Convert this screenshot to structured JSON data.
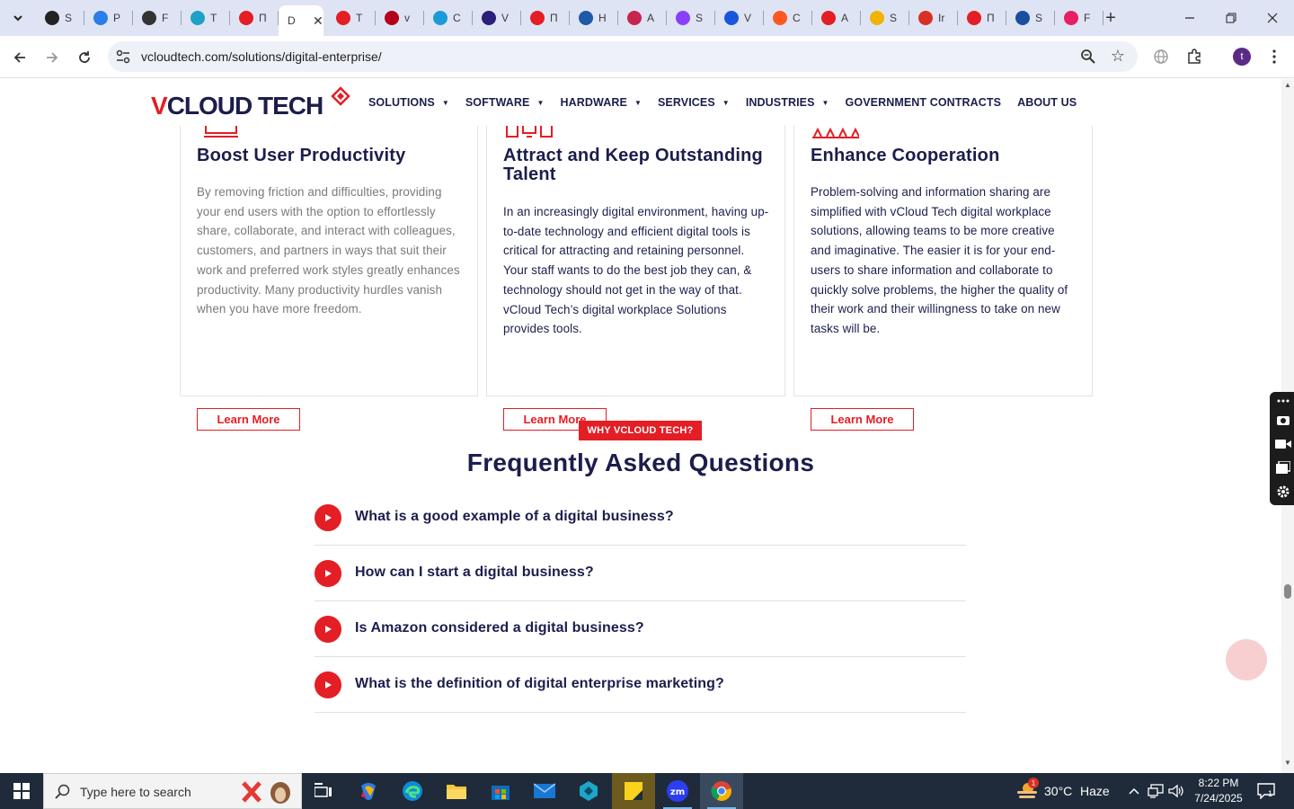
{
  "browser": {
    "tabs": [
      {
        "title": "S",
        "fav_color": "#222222",
        "fav_icon": "circle-logo-icon"
      },
      {
        "title": "P",
        "fav_color": "#2b7de9",
        "fav_icon": "gauge-icon"
      },
      {
        "title": "F",
        "fav_color": "#333333",
        "fav_icon": "openai-icon"
      },
      {
        "title": "T",
        "fav_color": "#1da1c4",
        "fav_icon": "cube-icon"
      },
      {
        "title": "П",
        "fav_color": "#e31e24",
        "fav_icon": "tag-icon"
      },
      {
        "title": "D",
        "fav_color": "#ffffff",
        "fav_icon": "blank-icon"
      },
      {
        "title": "T",
        "fav_color": "#e31e24",
        "fav_icon": "tag-icon"
      },
      {
        "title": "v",
        "fav_color": "#b3001b",
        "fav_icon": "v-check-icon"
      },
      {
        "title": "C",
        "fav_color": "#1a9bd7",
        "fav_icon": "hexagon-icon"
      },
      {
        "title": "V",
        "fav_color": "#2a1f7a",
        "fav_icon": "x-logo-icon"
      },
      {
        "title": "П",
        "fav_color": "#e31e24",
        "fav_icon": "tag-icon"
      },
      {
        "title": "H",
        "fav_color": "#1e5aa8",
        "fav_icon": "scale-icon"
      },
      {
        "title": "A",
        "fav_color": "#c7254e",
        "fav_icon": "puzzle-icon"
      },
      {
        "title": "S",
        "fav_color": "#8a3ffc",
        "fav_icon": "pen-icon"
      },
      {
        "title": "V",
        "fav_color": "#1a56db",
        "fav_icon": "pulse-icon"
      },
      {
        "title": "C",
        "fav_color": "#ff5722",
        "fav_icon": "swoosh-icon"
      },
      {
        "title": "A",
        "fav_color": "#e31e24",
        "fav_icon": "tag-icon"
      },
      {
        "title": "S",
        "fav_color": "#f0b400",
        "fav_icon": "ring-icon"
      },
      {
        "title": "Ir",
        "fav_color": "#d93025",
        "fav_icon": "gmail-icon"
      },
      {
        "title": "П",
        "fav_color": "#e31e24",
        "fav_icon": "tag-icon"
      },
      {
        "title": "S",
        "fav_color": "#1a4fa0",
        "fav_icon": "gear-icon"
      },
      {
        "title": "F",
        "fav_color": "#e91e63",
        "fav_icon": "ring-icon"
      }
    ],
    "url": "vcloudtech.com/solutions/digital-enterprise/",
    "avatar_letter": "t"
  },
  "site": {
    "logo": {
      "part1": "V",
      "part2": "CLOUD TECH"
    },
    "nav": [
      {
        "label": "SOLUTIONS",
        "has_caret": true
      },
      {
        "label": "SOFTWARE",
        "has_caret": true
      },
      {
        "label": "HARDWARE",
        "has_caret": true
      },
      {
        "label": "SERVICES",
        "has_caret": true
      },
      {
        "label": "INDUSTRIES",
        "has_caret": true
      },
      {
        "label": "GOVERNMENT CONTRACTS",
        "has_caret": false
      },
      {
        "label": "ABOUT US",
        "has_caret": false
      }
    ],
    "cards": [
      {
        "title": "Boost User Productivity",
        "text": "By removing friction and difficulties, providing your end users with the option to effortlessly share, collaborate, and interact with colleagues, customers, and partners in ways that suit their work and preferred work styles greatly enhances productivity. Many productivity hurdles vanish when you have more freedom.",
        "text_color": "#7a7a7a",
        "button": "Learn More"
      },
      {
        "title": "Attract and Keep Outstanding Talent",
        "text": "In an increasingly digital environment, having up-to-date technology and efficient digital tools is critical for attracting and retaining personnel. Your staff wants to do the best job they can, & technology should not get in the way of that. vCloud Tech’s digital workplace Solutions provides tools.",
        "text_color": "#1b1e4b",
        "button": "Learn More"
      },
      {
        "title": "Enhance Cooperation",
        "text": "Problem-solving and information sharing are simplified with vCloud Tech digital workplace solutions, allowing teams to be more creative and imaginative. The easier it is for your end-users to share information and collaborate to quickly solve problems, the higher the quality of their work and their willingness to take on new tasks will be.",
        "text_color": "#1b1e4b",
        "button": "Learn More"
      }
    ],
    "why_badge": "WHY VCLOUD TECH?",
    "faq_title": "Frequently Asked Questions",
    "faqs": [
      "What is a good example of a digital business?",
      "How can I start a digital business?",
      "Is Amazon considered a digital business?",
      "What is the definition of digital enterprise marketing?"
    ],
    "colors": {
      "brand_red": "#e31e24",
      "navy": "#1b1e4b"
    }
  },
  "taskbar": {
    "search_placeholder": "Type here to search",
    "weather_temp": "30°C",
    "weather_desc": "Haze",
    "weather_badge": "1",
    "time": "8:22 PM",
    "date": "7/24/2025",
    "notification_count": "1"
  }
}
